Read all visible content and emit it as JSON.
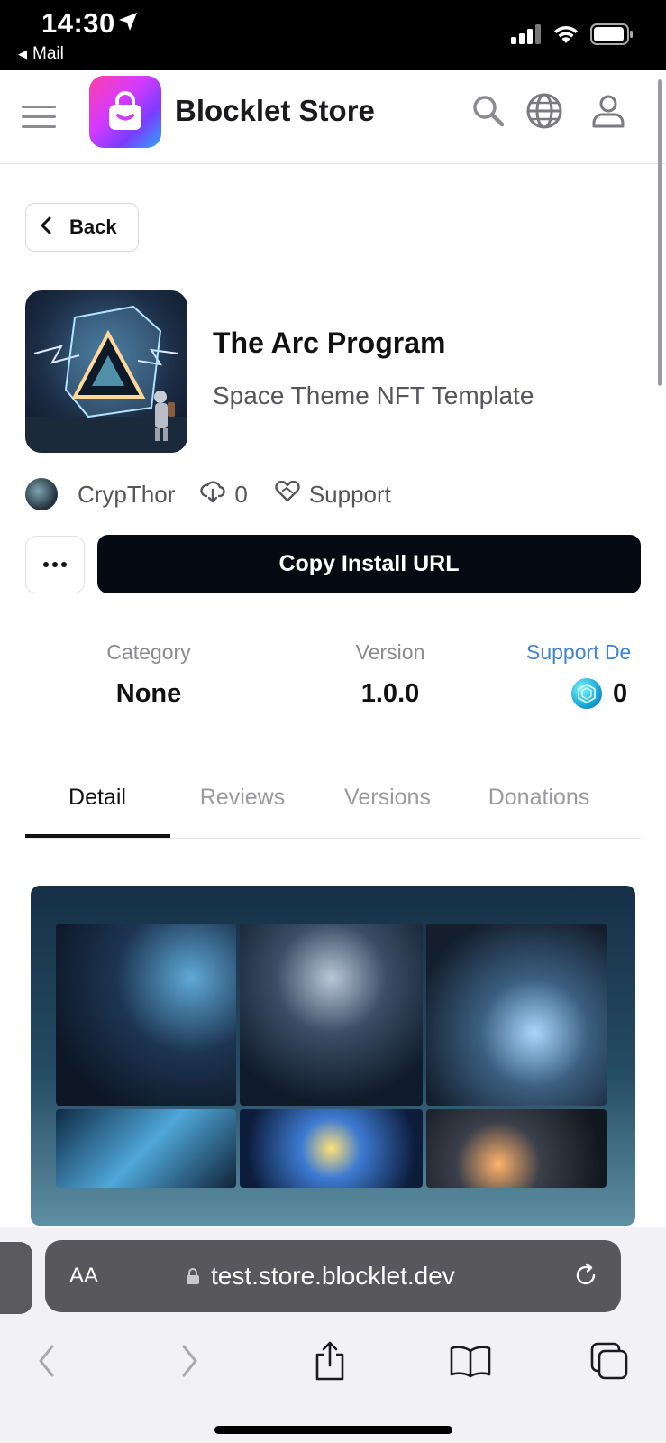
{
  "status_bar": {
    "time": "14:30",
    "back_app": "Mail"
  },
  "header": {
    "brand": "Blocklet Store"
  },
  "back_button": {
    "label": "Back"
  },
  "blocklet": {
    "title": "The Arc Program",
    "subtitle": "Space Theme NFT Template",
    "author": "CrypThor",
    "downloads": "0",
    "support_label": "Support"
  },
  "actions": {
    "install_label": "Copy Install URL"
  },
  "stats": {
    "category_label": "Category",
    "category_value": "None",
    "version_label": "Version",
    "version_value": "1.0.0",
    "support_label": "Support De",
    "support_value": "0"
  },
  "tabs": [
    {
      "label": "Detail",
      "active": true
    },
    {
      "label": "Reviews",
      "active": false
    },
    {
      "label": "Versions",
      "active": false
    },
    {
      "label": "Donations",
      "active": false
    }
  ],
  "browser": {
    "aa_label": "AA",
    "url": "test.store.blocklet.dev"
  },
  "colors": {
    "accent_link": "#3f82d6",
    "primary_button": "#060a13"
  }
}
